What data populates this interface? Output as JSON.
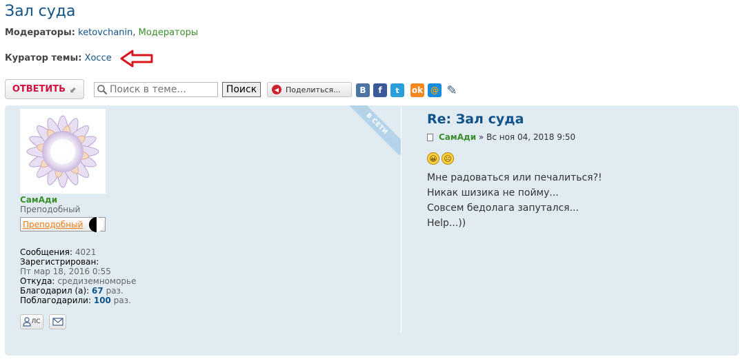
{
  "topic": {
    "title": "Зал суда",
    "moderators_label": "Модераторы:",
    "moderator_user": "ketovchanin",
    "moderator_group": "Модераторы",
    "curator_label": "Куратор темы:",
    "curator_name": "Хоссе"
  },
  "toolbar": {
    "reply_label": "ОТВЕТИТЬ",
    "search_placeholder": "Поиск в теме...",
    "search_button": "Поиск",
    "share_label": "Поделиться..."
  },
  "social_icons": [
    "vk-icon",
    "facebook-icon",
    "twitter-icon",
    "odnoklassniki-icon",
    "mailru-icon",
    "livejournal-icon"
  ],
  "post": {
    "online_badge": "В СЕТИ",
    "title": "Re: Зал суда",
    "author": "СамАди",
    "meta_sep": " » ",
    "date": "Вс ноя 04, 2018 9:50",
    "lines": [
      "Мне радоваться или печалиться?!",
      "Никак шизика не пойму...",
      "Совсем бедолага запутался...",
      "Help...))"
    ]
  },
  "profile": {
    "author": "СамАди",
    "rank": "Преподобный",
    "rank_image_text": "Преподобный",
    "posts_label": "Сообщения:",
    "posts": "4021",
    "registered_label": "Зарегистрирован:",
    "registered": "Пт мар 18, 2016 0:55",
    "location_label": "Откуда:",
    "location": "средиземноморье",
    "thanked_label": "Благодарил (а):",
    "thanked": "67",
    "thanked_suffix": "раз.",
    "was_thanked_label": "Поблагодарили:",
    "was_thanked": "100",
    "was_thanked_suffix": "раз.",
    "pm_label": "ЛС"
  },
  "colors": {
    "title_blue": "#105289",
    "post_bg": "#e1ebf2",
    "reply_red": "#d31141",
    "user_green": "#3a8f2a"
  }
}
